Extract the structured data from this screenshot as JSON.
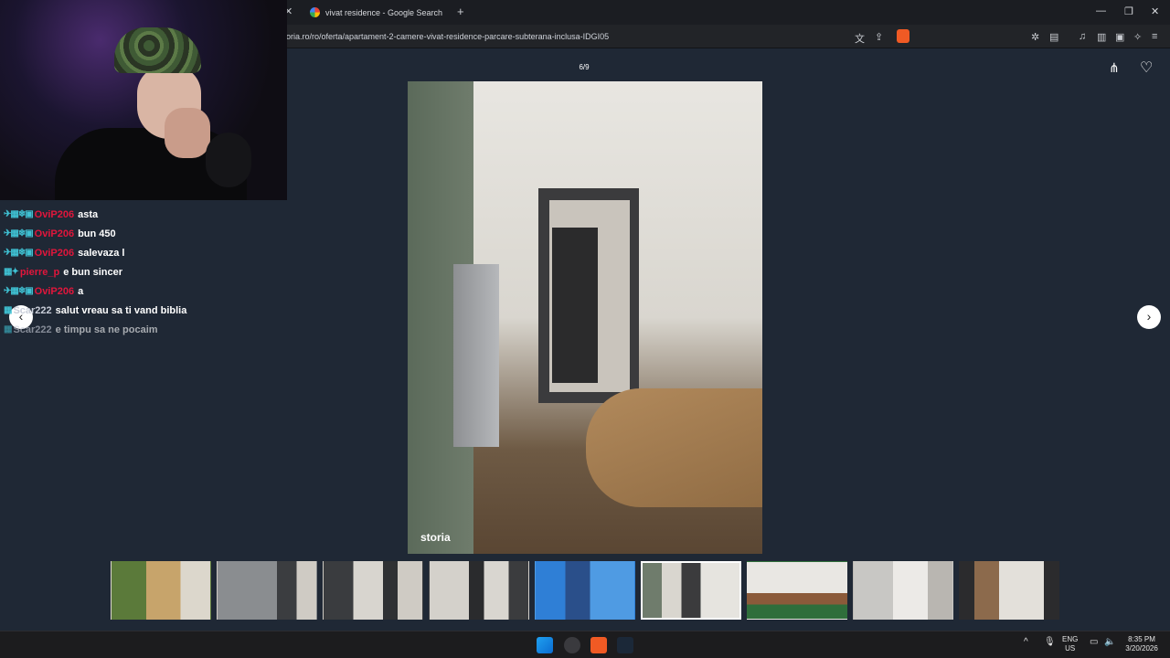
{
  "browser": {
    "tabs": [
      {
        "title": "vivat residence - Google Search"
      }
    ],
    "url": "oria.ro/ro/oferta/apartament-2-camere-vivat-residence-parcare-subterana-inclusa-IDGI05"
  },
  "chat": {
    "messages": [
      {
        "user": "OviP206",
        "text": "asta",
        "badges": "✈▦❄▣"
      },
      {
        "user": "OviP206",
        "text": "bun 450",
        "badges": "✈▦❄▣"
      },
      {
        "user": "OviP206",
        "text": "salevaza l",
        "badges": "✈▦❄▣"
      },
      {
        "user": "pierre_p",
        "text": "e bun sincer",
        "badges": "▦✦"
      },
      {
        "user": "OviP206",
        "text": "a",
        "badges": "✈▦❄▣"
      },
      {
        "user": "Scar222",
        "text": "salut vreau sa ti vand biblia",
        "badges": "▦"
      },
      {
        "user": "Scar222",
        "text": "e timpu sa ne pocaim",
        "badges": "▦"
      }
    ]
  },
  "gallery": {
    "counter": "6/9",
    "logo": "storia",
    "selected_index": 5,
    "thumb_count": 9
  },
  "taskbar": {
    "lang": "ENG",
    "region": "US",
    "time": "8:35 PM",
    "date": "3/20/2026"
  },
  "icons": [
    "close-icon",
    "plus-icon",
    "minimize-icon",
    "maximize-icon",
    "translate-icon",
    "share-icon",
    "brave-icon",
    "extensions-icon",
    "heart-icon",
    "chevron-left-icon",
    "chevron-right-icon",
    "windows-icon",
    "steam-icon"
  ]
}
